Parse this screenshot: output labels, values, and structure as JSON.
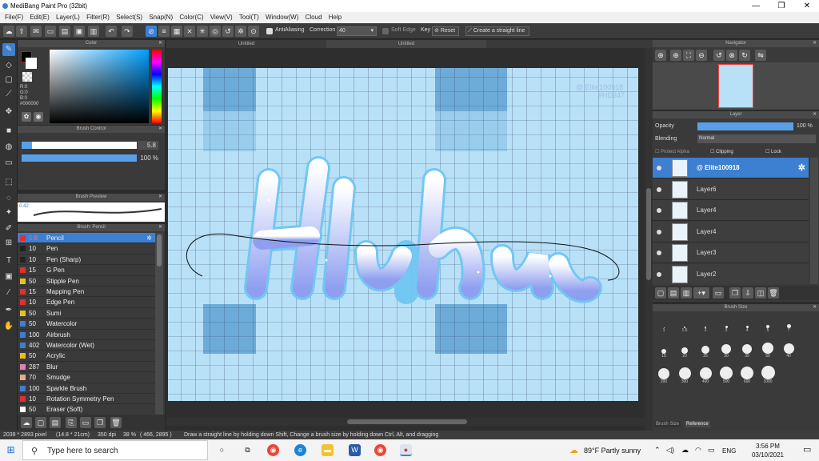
{
  "window": {
    "title": "MediBang Paint Pro (32bit)",
    "minimize": "—",
    "maximize": "❐",
    "close": "✕"
  },
  "menu": [
    "File(F)",
    "Edit(E)",
    "Layer(L)",
    "Filter(R)",
    "Select(S)",
    "Snap(N)",
    "Color(C)",
    "View(V)",
    "Tool(T)",
    "Window(W)",
    "Cloud",
    "Help"
  ],
  "toolbar": {
    "antialiasing_label": "AntiAliasing",
    "correction_label": "Correction",
    "correction_value": "40",
    "soft_edge_label": "Soft Edge",
    "key_label": "Key",
    "reset_label": "Reset",
    "create_line_label": "Create a straight line"
  },
  "tabs": {
    "tab1": "Untitled",
    "tab2": "Untitled"
  },
  "color_panel": {
    "title": "Color",
    "r": "R:0",
    "g": "G:0",
    "b": "B:0",
    "hex": "#000000",
    "fg_color": "#000000",
    "bg_color": "#ffffff"
  },
  "brush_control": {
    "title": "Brush Control",
    "size_value": "5.8",
    "opacity_value": "100 %"
  },
  "brush_preview": {
    "title": "Brush Preview",
    "size": "0.42"
  },
  "brush_list": {
    "title": "Brush: Pencil",
    "items": [
      {
        "size": "5.8",
        "name": "Pencil",
        "color": "#e03030",
        "selected": true
      },
      {
        "size": "10",
        "name": "Pen",
        "color": "#222222"
      },
      {
        "size": "10",
        "name": "Pen (Sharp)",
        "color": "#222222"
      },
      {
        "size": "15",
        "name": "G Pen",
        "color": "#e03030"
      },
      {
        "size": "50",
        "name": "Stipple Pen",
        "color": "#e6c020"
      },
      {
        "size": "15",
        "name": "Mapping Pen",
        "color": "#e03030"
      },
      {
        "size": "10",
        "name": "Edge Pen",
        "color": "#e03030"
      },
      {
        "size": "50",
        "name": "Sumi",
        "color": "#e6c020"
      },
      {
        "size": "50",
        "name": "Watercolor",
        "color": "#3d7fd0"
      },
      {
        "size": "100",
        "name": "Airbrush",
        "color": "#3d7fd0"
      },
      {
        "size": "402",
        "name": "Watercolor (Wet)",
        "color": "#3d7fd0"
      },
      {
        "size": "50",
        "name": "Acrylic",
        "color": "#e6c020"
      },
      {
        "size": "287",
        "name": "Blur",
        "color": "#e080c0"
      },
      {
        "size": "70",
        "name": "Smudge",
        "color": "#e0b080"
      },
      {
        "size": "100",
        "name": "Sparkle Brush",
        "color": "#3d7fd0"
      },
      {
        "size": "10",
        "name": "Rotation Symmetry Pen",
        "color": "#e03030"
      },
      {
        "size": "50",
        "name": "Eraser (Soft)",
        "color": "#ffffff"
      }
    ]
  },
  "navigator": {
    "title": "Navigator"
  },
  "layer_panel": {
    "title": "Layer",
    "opacity_label": "Opacity",
    "opacity_value": "100 %",
    "opacity_level": 1.0,
    "blending_label": "Blending",
    "blending_value": "Normal",
    "protect_alpha": "Protect Alpha",
    "clipping": "Clipping",
    "lock": "Lock",
    "layers": [
      {
        "name": "@ Elite100918",
        "selected": true
      },
      {
        "name": "Layer6"
      },
      {
        "name": "Layer4"
      },
      {
        "name": "Layer4"
      },
      {
        "name": "Layer3"
      },
      {
        "name": "Layer2"
      }
    ]
  },
  "brush_size_panel": {
    "title": "Brush Size",
    "tab_brush_size": "Brush Size",
    "tab_reference": "Reference",
    "row1": [
      ".",
      "",
      ".",
      ".",
      ".",
      ".",
      "",
      ""
    ],
    "row1_labels": [
      "1",
      "1.5",
      "2",
      "3",
      "4",
      "5",
      "7",
      ""
    ],
    "row2_labels": [
      "15",
      "20",
      "25",
      "30",
      "35",
      "50",
      "40",
      ""
    ],
    "row3_labels": [
      "200",
      "300",
      "400",
      "500",
      "600",
      "1000",
      "",
      ""
    ]
  },
  "canvas": {
    "watermark1": "@ Elite100918",
    "watermark2": "#HD247",
    "artwork_text": "Haru"
  },
  "status": {
    "dims": "2039 * 2893 pixel",
    "size_cm": "(14.8 * 21cm)",
    "dpi": "350 dpi",
    "zoom": "38 %",
    "coords": "( 466, 2895 )",
    "hint": "Draw a straight line by holding down Shift, Change a brush size by holding down Ctrl, Alt, and dragging"
  },
  "taskbar": {
    "search_placeholder": "Type here to search",
    "weather": "89°F  Partly sunny",
    "lang": "ENG",
    "time": "3:56 PM",
    "date": "03/10/2021"
  }
}
